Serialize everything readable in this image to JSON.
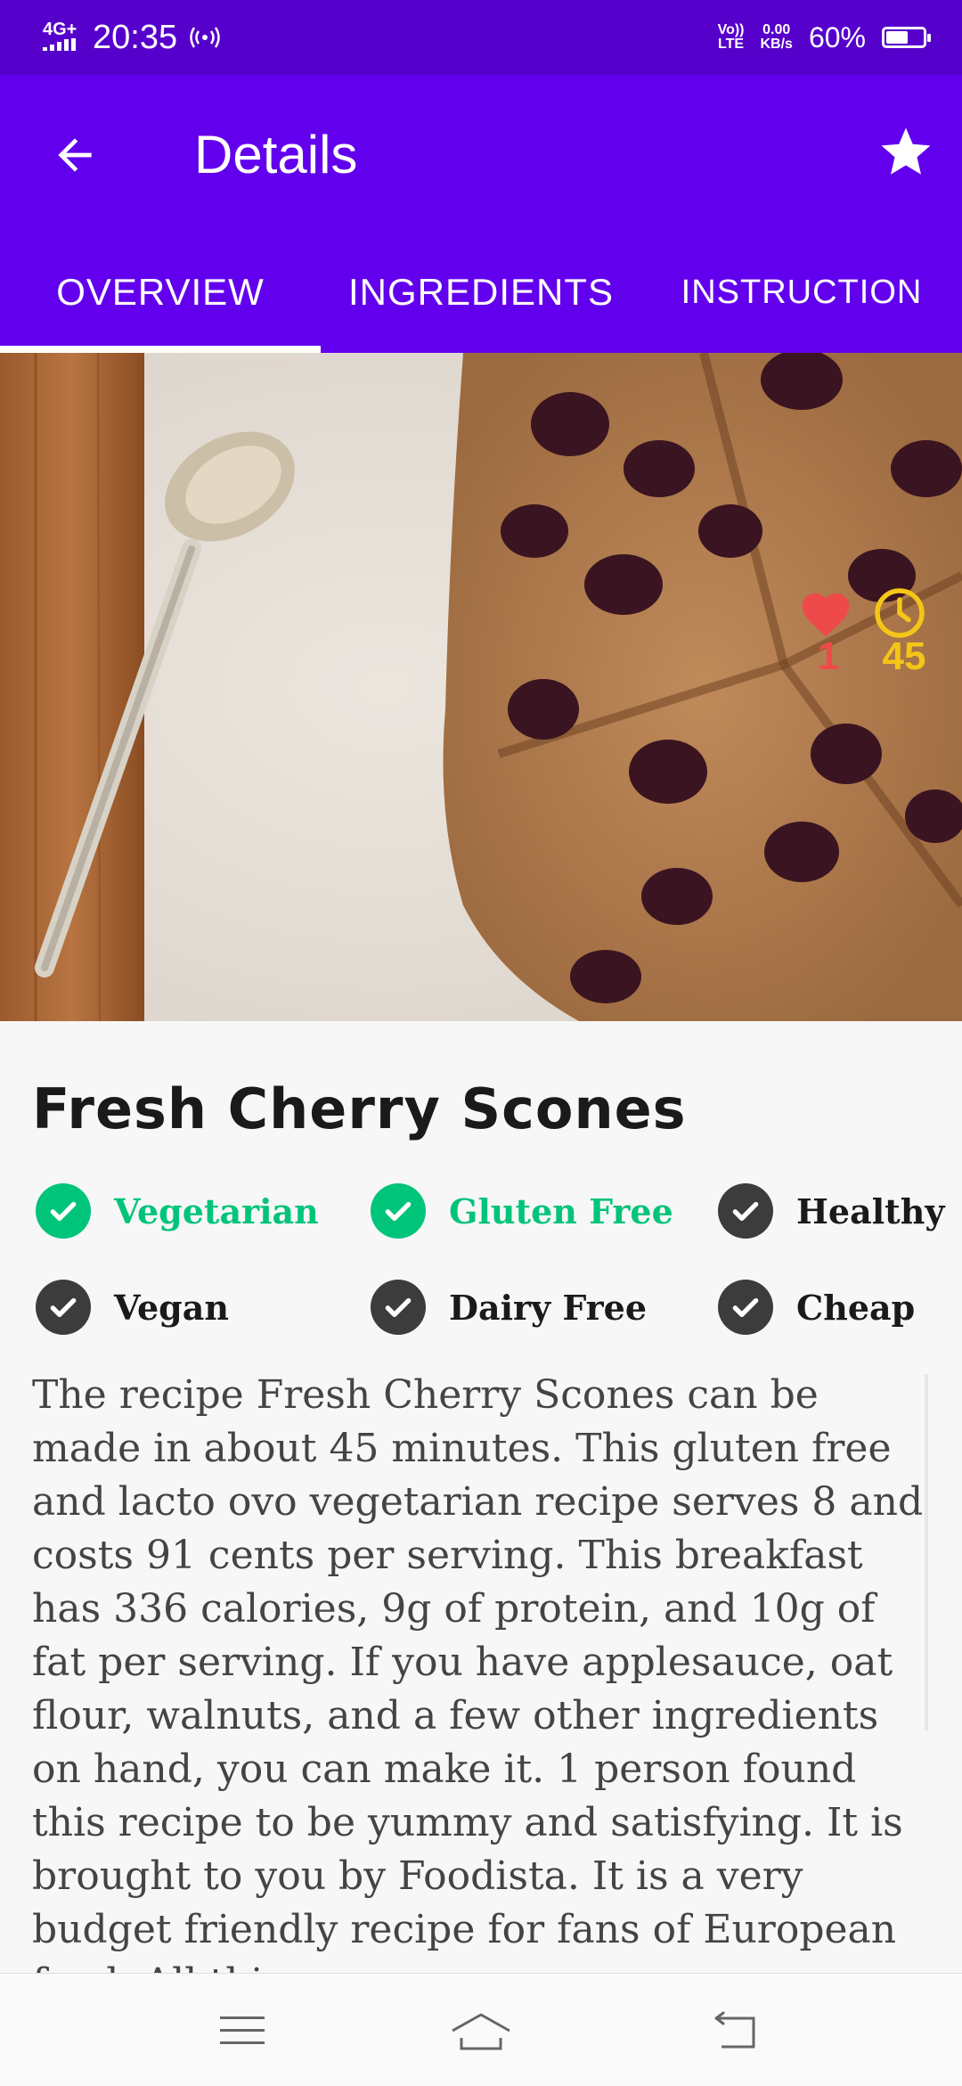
{
  "status_bar": {
    "network": "4G+",
    "time": "20:35",
    "volte_top": "Vo))",
    "volte_bottom": "LTE",
    "speed_value": "0.00",
    "speed_unit": "KB/s",
    "battery": "60%",
    "battery_level": 0.6
  },
  "app_bar": {
    "title": "Details",
    "back_icon": "arrow-left-icon",
    "favorite_icon": "star-icon"
  },
  "tabs": [
    {
      "label": "OVERVIEW",
      "selected": true
    },
    {
      "label": "INGREDIENTS",
      "selected": false
    },
    {
      "label": "INSTRUCTION",
      "selected": false
    }
  ],
  "hero": {
    "likes": "1",
    "minutes": "45",
    "likes_icon": "heart-icon",
    "time_icon": "clock-icon"
  },
  "recipe": {
    "title": "Fresh Cherry Scones",
    "tags": [
      {
        "label": "Vegetarian",
        "active": true
      },
      {
        "label": "Gluten Free",
        "active": true
      },
      {
        "label": "Healthy",
        "active": false
      },
      {
        "label": "Vegan",
        "active": false
      },
      {
        "label": "Dairy Free",
        "active": false
      },
      {
        "label": "Cheap",
        "active": false
      }
    ],
    "description": "The recipe Fresh Cherry Scones can be made in about 45 minutes. This gluten free and lacto ovo vegetarian recipe serves 8 and costs 91 cents per serving. This breakfast has 336 calories, 9g of protein, and 10g of fat per serving. If you have applesauce, oat flour, walnuts, and a few other ingredients on hand, you can make it. 1 person found this recipe to be yummy and satisfying. It is brought to you by Foodista. It is a very budget friendly recipe for fans of European food. All things"
  },
  "colors": {
    "status_bar": "#5600cc",
    "primary": "#6200ee",
    "active_green": "#00c47a",
    "inactive_dark": "#3c3c3c",
    "heart_red": "#ef4a4a",
    "clock_yellow": "#f5c518"
  },
  "nav_bar": {
    "menu_icon": "menu-icon",
    "home_icon": "home-icon",
    "back_icon": "back-icon"
  }
}
